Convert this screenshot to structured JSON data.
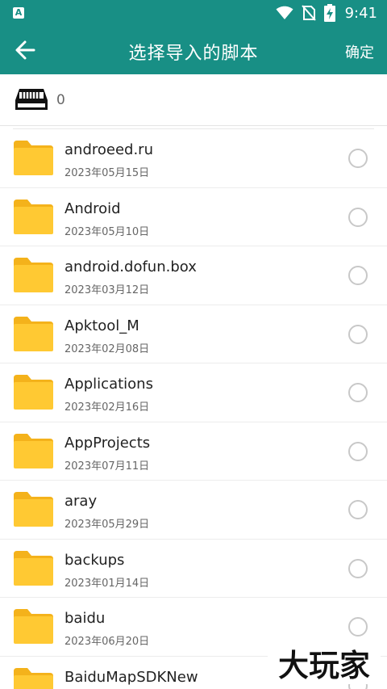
{
  "status_bar": {
    "time": "9:41",
    "left_badge": "A"
  },
  "app_bar": {
    "title": "选择导入的脚本",
    "confirm_label": "确定"
  },
  "storage": {
    "count": "0"
  },
  "files": [
    {
      "name": "androeed.ru",
      "date": "2023年05月15日"
    },
    {
      "name": "Android",
      "date": "2023年05月10日"
    },
    {
      "name": "android.dofun.box",
      "date": "2023年03月12日"
    },
    {
      "name": "Apktool_M",
      "date": "2023年02月08日"
    },
    {
      "name": "Applications",
      "date": "2023年02月16日"
    },
    {
      "name": "AppProjects",
      "date": "2023年07月11日"
    },
    {
      "name": "aray",
      "date": "2023年05月29日"
    },
    {
      "name": "backups",
      "date": "2023年01月14日"
    },
    {
      "name": "baidu",
      "date": "2023年06月20日"
    },
    {
      "name": "BaiduMapSDKNew",
      "date": ""
    }
  ],
  "watermark": {
    "text": "大玩家"
  },
  "colors": {
    "primary": "#188f85",
    "folder": "#ffc933",
    "folder_dark": "#f4b21b",
    "text": "#222222",
    "subtext": "#666666"
  }
}
